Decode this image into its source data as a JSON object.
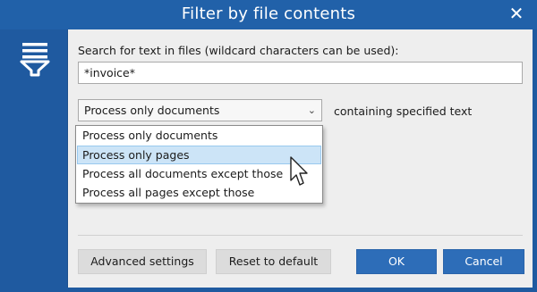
{
  "window": {
    "title": "Filter by file contents",
    "close_glyph": "✕"
  },
  "sidebar": {
    "icon": "filter-funnel-icon"
  },
  "search": {
    "label": "Search for text in files (wildcard characters can be used):",
    "value": "*invoice*"
  },
  "mode": {
    "selected": "Process only documents",
    "suffix": "containing specified text",
    "options": [
      "Process only documents",
      "Process only pages",
      "Process all documents except those",
      "Process all pages except those"
    ],
    "highlighted_option": "Process only pages"
  },
  "buttons": {
    "advanced": "Advanced settings",
    "reset": "Reset to default",
    "ok": "OK",
    "cancel": "Cancel"
  },
  "colors": {
    "titlebar": "#2161a9",
    "sidebar": "#1f5aa0",
    "primary_button": "#2d6db8",
    "highlight": "#cce4f7"
  }
}
